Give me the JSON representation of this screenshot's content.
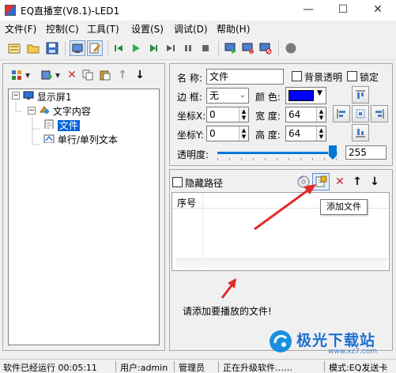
{
  "window": {
    "title": "EQ直播室(V8.1)-LED1",
    "minimize": "—",
    "maximize": "☐",
    "close": "✕"
  },
  "menu": [
    "文件(F)",
    "控制(C)",
    "工具(T)",
    "设置(S)",
    "调试(D)",
    "帮助(H)"
  ],
  "tree": {
    "root": "显示屏1",
    "group": "文字内容",
    "file": "文件",
    "text": "单行/单列文本"
  },
  "props": {
    "name_label": "名 称:",
    "name_value": "文件",
    "bg_transparent_label": "背景透明",
    "lock_label": "锁定",
    "border_label": "边 框:",
    "border_value": "无",
    "color_label": "颜 色:",
    "color_value": "#0000ff",
    "x_label": "坐标X:",
    "x_value": "0",
    "width_label": "宽 度:",
    "width_value": "64",
    "y_label": "坐标Y:",
    "y_value": "0",
    "height_label": "高 度:",
    "height_value": "64",
    "opacity_label": "透明度:",
    "opacity_value": "255",
    "opacity_fraction": 1.0
  },
  "list": {
    "hide_path_label": "隐藏路径",
    "column_seq": "序号",
    "hint": "请添加要播放的文件!",
    "tooltip": "添加文件"
  },
  "status": {
    "running": "软件已经运行 00:05:11",
    "user": "用户:admin",
    "role": "管理员",
    "upgrading": "正在升级软件……",
    "mode": "模式:EQ发送卡"
  },
  "watermark": {
    "text": "极光下载站",
    "url": "www.xz7.com"
  },
  "colors": {
    "accent": "#0078d7",
    "arrow": "#e12a2a",
    "select": "#0a64d8"
  }
}
